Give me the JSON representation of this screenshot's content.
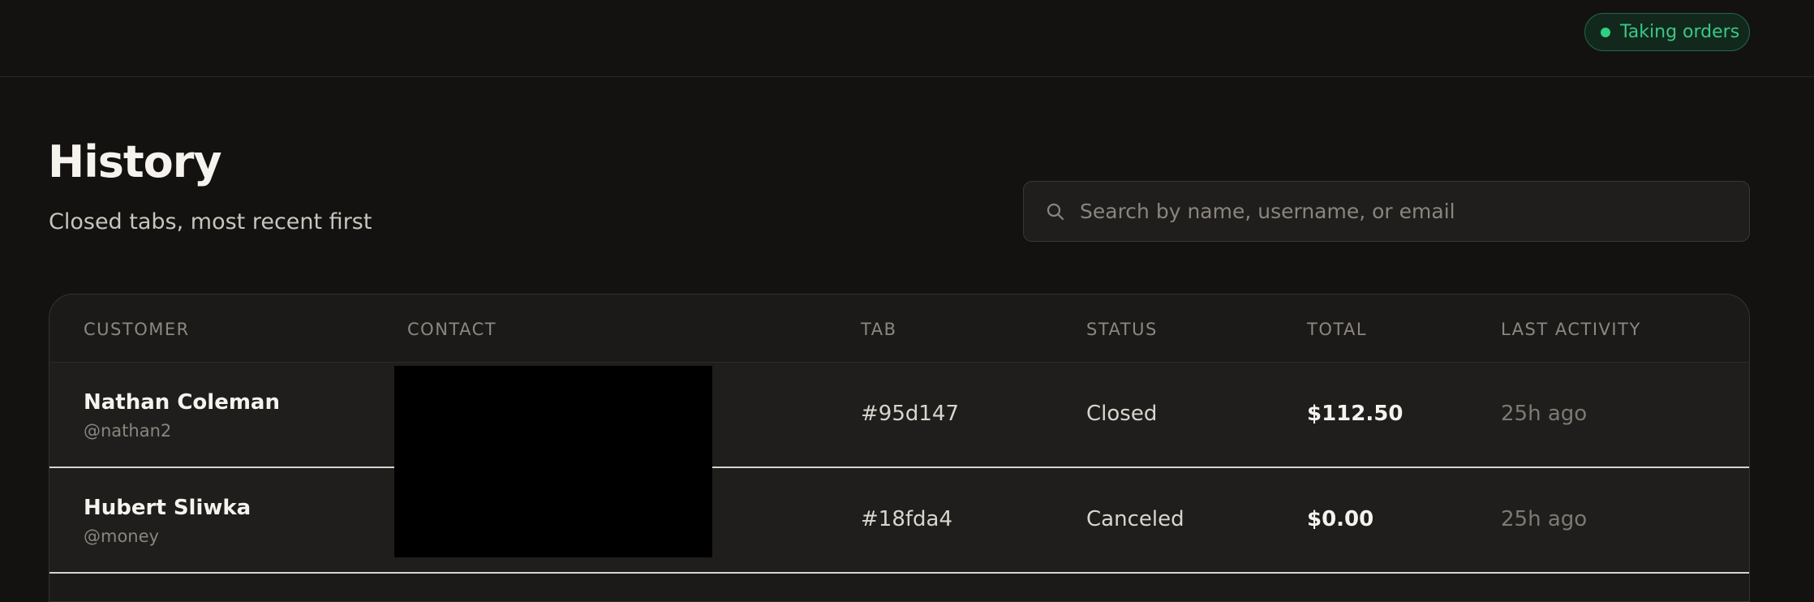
{
  "header": {
    "status_label": "Taking orders",
    "status_color": "#2fd082"
  },
  "page": {
    "title": "History",
    "subtitle": "Closed tabs, most recent first"
  },
  "search": {
    "placeholder": "Search by name, username, or email",
    "value": ""
  },
  "table": {
    "columns": [
      "CUSTOMER",
      "CONTACT",
      "TAB",
      "STATUS",
      "TOTAL",
      "LAST ACTIVITY"
    ],
    "rows": [
      {
        "name": "Nathan Coleman",
        "username": "@nathan2",
        "tab": "#95d147",
        "status": "Closed",
        "total": "$112.50",
        "last_activity": "25h ago"
      },
      {
        "name": "Hubert Sliwka",
        "username": "@money",
        "tab": "#18fda4",
        "status": "Canceled",
        "total": "$0.00",
        "last_activity": "25h ago"
      }
    ]
  }
}
